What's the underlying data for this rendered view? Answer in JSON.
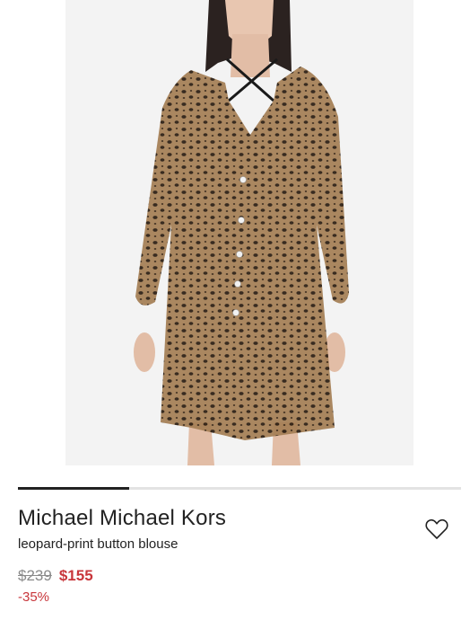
{
  "product": {
    "brand": "Michael Michael Kors",
    "description": "leopard-print button blouse",
    "original_price": "$239",
    "sale_price": "$155",
    "discount": "-35%"
  },
  "gallery": {
    "current_index": 1,
    "total": 4
  },
  "icons": {
    "wishlist": "heart-outline-icon"
  },
  "colors": {
    "sale": "#c8363b",
    "text": "#222222",
    "muted": "#8a8a8a"
  }
}
